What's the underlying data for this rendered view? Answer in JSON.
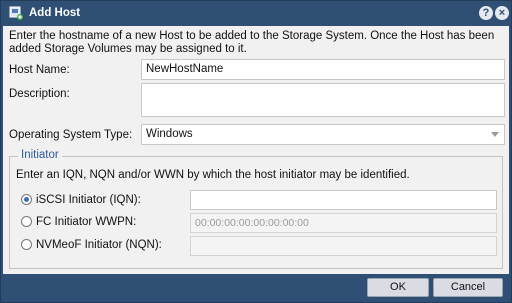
{
  "dialog": {
    "title": "Add Host",
    "help_label": "?",
    "close_label": "×"
  },
  "intro_text": "Enter the hostname of a new Host to be added to the Storage System. Once the Host has been added Storage Volumes may be assigned to it.",
  "form": {
    "host_name_label": "Host Name:",
    "host_name_value": "NewHostName",
    "description_label": "Description:",
    "description_value": "",
    "os_type_label": "Operating System Type:",
    "os_type_value": "Windows"
  },
  "initiator": {
    "legend": "Initiator",
    "instructions": "Enter an IQN, NQN and/or WWN by which the host initiator may be identified.",
    "options": [
      {
        "label": "iSCSI Initiator (IQN):",
        "value": "",
        "checked": true
      },
      {
        "label": "FC Initiator WWPN:",
        "value": "00:00:00:00:00:00:00:00",
        "checked": false
      },
      {
        "label": "NVMeoF Initiator (NQN):",
        "value": "",
        "checked": false
      }
    ]
  },
  "footer": {
    "ok_label": "OK",
    "cancel_label": "Cancel"
  },
  "colors": {
    "title_bar": "#2f4f75",
    "legend_text": "#2f5a9a",
    "radio_selected": "#3a6bbf"
  }
}
